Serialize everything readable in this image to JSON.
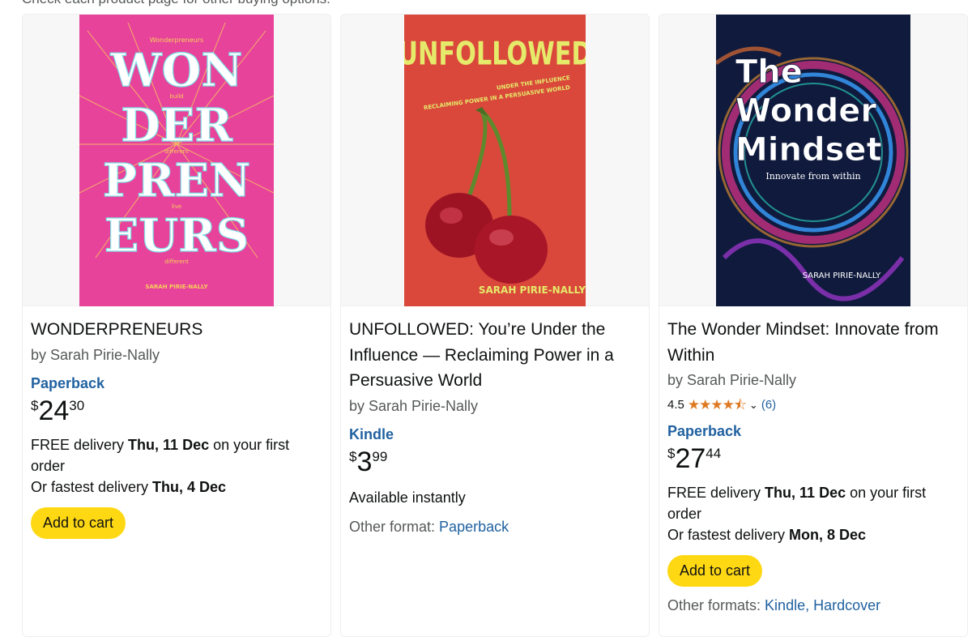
{
  "notice": "Check each product page for other buying options.",
  "products": [
    {
      "title": "WONDERPRENEURS",
      "author": "by Sarah Pirie-Nally",
      "format": "Paperback",
      "price": {
        "symbol": "$",
        "whole": "24",
        "fraction": "30"
      },
      "delivery_prefix": "FREE delivery ",
      "delivery_date": "Thu, 11 Dec",
      "delivery_suffix": " on your first order",
      "fastest_prefix": "Or fastest delivery ",
      "fastest_date": "Thu, 4 Dec",
      "cart_label": "Add to cart",
      "cover": {
        "top": "Wonderpreneurs",
        "lines": [
          "WON",
          "DER",
          "PREN",
          "EURS"
        ],
        "small": [
          "build",
          "different",
          "live",
          "different"
        ],
        "author": "SARAH PIRIE-NALLY",
        "bg": "#e8439b"
      }
    },
    {
      "title": "UNFOLLOWED: You’re Under the Influence — Reclaiming Power in a Persuasive World",
      "author": "by Sarah Pirie-Nally",
      "format": "Kindle",
      "price": {
        "symbol": "$",
        "whole": "3",
        "fraction": "99"
      },
      "availability": "Available instantly",
      "other_label": "Other format: ",
      "other_links": "Paperback",
      "cover": {
        "title": "UNFOLLOWED",
        "sub1": "UNDER THE INFLUENCE",
        "sub2": "RECLAIMING POWER IN A PERSUASIVE WORLD",
        "author": "SARAH PIRIE-NALLY",
        "bg": "#d9483b"
      }
    },
    {
      "title": "The Wonder Mindset: Innovate from Within",
      "author": "by Sarah Pirie-Nally",
      "rating_value": "4.5",
      "rating_stars": "★★★★⯪",
      "rating_count": "(6)",
      "format": "Paperback",
      "price": {
        "symbol": "$",
        "whole": "27",
        "fraction": "44"
      },
      "delivery_prefix": "FREE delivery ",
      "delivery_date": "Thu, 11 Dec",
      "delivery_suffix": " on your first order",
      "fastest_prefix": "Or fastest delivery ",
      "fastest_date": "Mon, 8 Dec",
      "cart_label": "Add to cart",
      "other_label": "Other formats: ",
      "other_links": "Kindle, Hardcover",
      "cover": {
        "l1": "The",
        "l2": "Wonder",
        "l3": "Mindset",
        "tag": "Innovate from within",
        "author": "SARAH PIRIE-NALLY",
        "bg": "#0f1a3d"
      }
    }
  ],
  "colors": {
    "link": "#2162a1",
    "button": "#ffd814",
    "star": "#de7921"
  }
}
